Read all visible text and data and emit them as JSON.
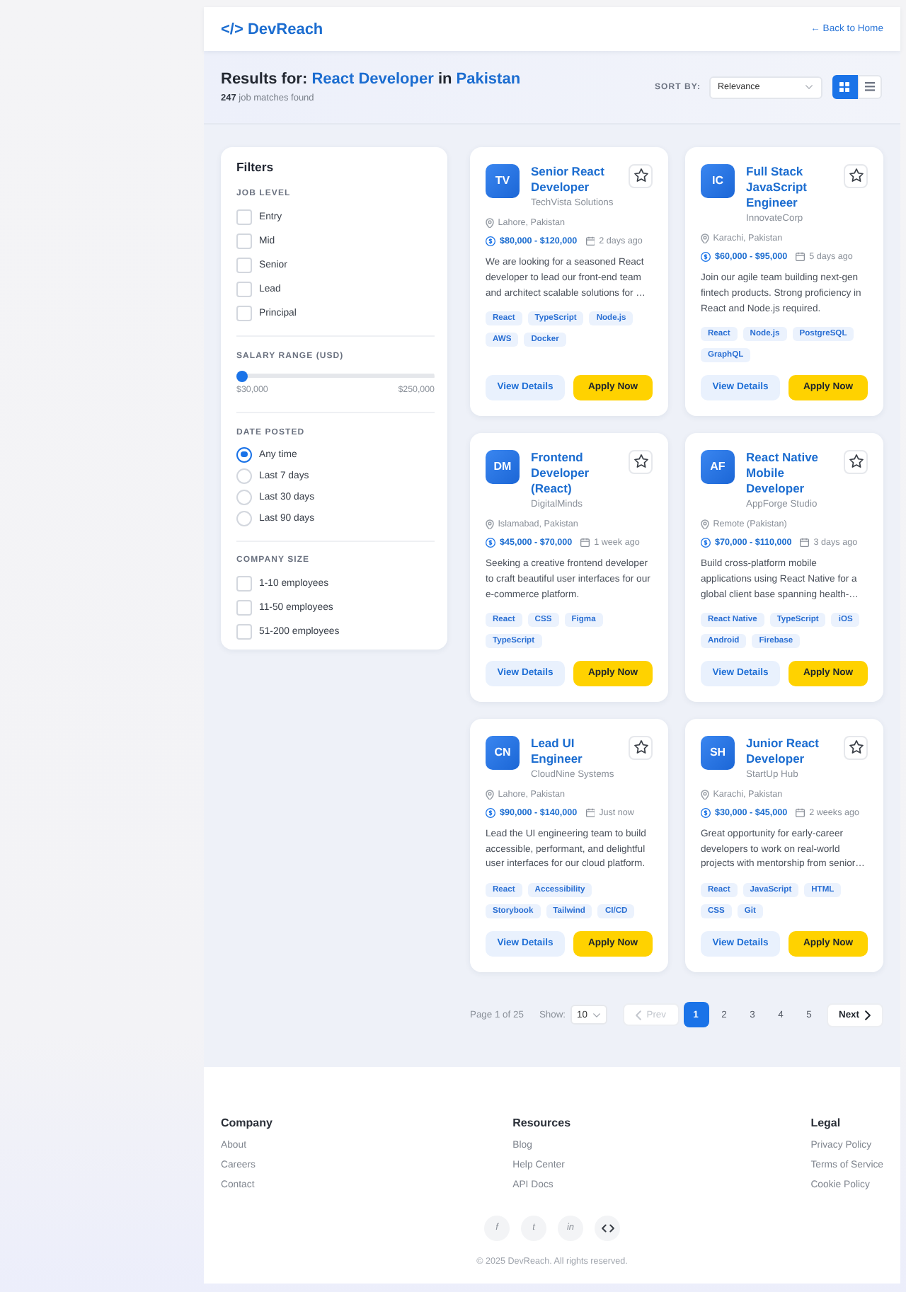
{
  "header": {
    "logo": "</> DevReach",
    "back_link": "← Back to Home"
  },
  "results": {
    "prefix": "Results for:",
    "query": "React Developer",
    "joiner": "in",
    "location": "Pakistan",
    "count": "**247** job matches found",
    "sort_label": "SORT BY:",
    "sort_value": "Relevance",
    "views": [
      {
        "kind": "grid",
        "selected": true
      },
      {
        "kind": "list",
        "selected": false
      }
    ]
  },
  "filters": {
    "title": "Filters",
    "sections": [
      {
        "kind": "checkbox",
        "title": "JOB LEVEL",
        "options": [
          {
            "label": "Entry",
            "checked": false
          },
          {
            "label": "Mid",
            "checked": false
          },
          {
            "label": "Senior",
            "checked": false
          },
          {
            "label": "Lead",
            "checked": false
          },
          {
            "label": "Principal",
            "checked": false
          }
        ]
      },
      {
        "kind": "range",
        "title": "SALARY RANGE (USD)",
        "level": 0,
        "min_label": "$30,000",
        "max_label": "$250,000"
      },
      {
        "kind": "radio",
        "title": "DATE POSTED",
        "options": [
          {
            "label": "Any time",
            "selected": true
          },
          {
            "label": "Last 7 days",
            "selected": false
          },
          {
            "label": "Last 30 days",
            "selected": false
          },
          {
            "label": "Last 90 days",
            "selected": false
          }
        ]
      },
      {
        "kind": "checkbox",
        "title": "COMPANY SIZE",
        "options": [
          {
            "label": "1-10 employees",
            "checked": false
          },
          {
            "label": "11-50 employees",
            "checked": false
          },
          {
            "label": "51-200 employees",
            "checked": false
          }
        ]
      }
    ]
  },
  "jobs": [
    {
      "initials": "TV",
      "title": "Senior React Developer",
      "company": "TechVista Solutions",
      "saved": false,
      "location": "Lahore, Pakistan",
      "salary": "$80,000 - $120,000",
      "posted": "2 days ago",
      "description": "We are looking for a seasoned React developer to lead our front-end team and architect scalable solutions for …",
      "tags": [
        "React",
        "TypeScript",
        "Node.js",
        "AWS",
        "Docker"
      ],
      "details_button": "View Details",
      "apply_button": "Apply Now"
    },
    {
      "initials": "IC",
      "title": "Full Stack JavaScript Engineer",
      "company": "InnovateCorp",
      "saved": false,
      "location": "Karachi, Pakistan",
      "salary": "$60,000 - $95,000",
      "posted": "5 days ago",
      "description": "Join our agile team building next-gen fintech products. Strong proficiency in React and Node.js required.",
      "tags": [
        "React",
        "Node.js",
        "PostgreSQL",
        "GraphQL"
      ],
      "details_button": "View Details",
      "apply_button": "Apply Now"
    },
    {
      "initials": "DM",
      "title": "Frontend Developer (React)",
      "company": "DigitalMinds",
      "saved": false,
      "location": "Islamabad, Pakistan",
      "salary": "$45,000 - $70,000",
      "posted": "1 week ago",
      "description": "Seeking a creative frontend developer to craft beautiful user interfaces for our e-commerce platform.",
      "tags": [
        "React",
        "CSS",
        "Figma",
        "TypeScript"
      ],
      "details_button": "View Details",
      "apply_button": "Apply Now"
    },
    {
      "initials": "AF",
      "title": "React Native Mobile Developer",
      "company": "AppForge Studio",
      "saved": false,
      "location": "Remote (Pakistan)",
      "salary": "$70,000 - $110,000",
      "posted": "3 days ago",
      "description": "Build cross-platform mobile applications using React Native for a global client base spanning health-…",
      "tags": [
        "React Native",
        "TypeScript",
        "iOS",
        "Android",
        "Firebase"
      ],
      "details_button": "View Details",
      "apply_button": "Apply Now"
    },
    {
      "initials": "CN",
      "title": "Lead UI Engineer",
      "company": "CloudNine Systems",
      "saved": false,
      "location": "Lahore, Pakistan",
      "salary": "$90,000 - $140,000",
      "posted": "Just now",
      "description": "Lead the UI engineering team to build accessible, performant, and delightful user interfaces for our cloud platform.",
      "tags": [
        "React",
        "Accessibility",
        "Storybook",
        "Tailwind",
        "CI/CD"
      ],
      "details_button": "View Details",
      "apply_button": "Apply Now"
    },
    {
      "initials": "SH",
      "title": "Junior React Developer",
      "company": "StartUp Hub",
      "saved": false,
      "location": "Karachi, Pakistan",
      "salary": "$30,000 - $45,000",
      "posted": "2 weeks ago",
      "description": "Great opportunity for early-career developers to work on real-world projects with mentorship from senior…",
      "tags": [
        "React",
        "JavaScript",
        "HTML",
        "CSS",
        "Git"
      ],
      "details_button": "View Details",
      "apply_button": "Apply Now"
    }
  ],
  "pagination": {
    "page_info": "Page 1 of 25",
    "show_label": "Show:",
    "page_size": "10",
    "prev": {
      "label": "Prev",
      "disabled": true
    },
    "pages": [
      {
        "label": "1",
        "selected": true
      },
      {
        "label": "2",
        "selected": false
      },
      {
        "label": "3",
        "selected": false
      },
      {
        "label": "4",
        "selected": false
      },
      {
        "label": "5",
        "selected": false
      }
    ],
    "next": {
      "label": "Next",
      "disabled": false
    }
  },
  "footer": {
    "columns": [
      {
        "title": "Company",
        "links": [
          "About",
          "Careers",
          "Contact"
        ]
      },
      {
        "title": "Resources",
        "links": [
          "Blog",
          "Help Center",
          "API Docs"
        ]
      },
      {
        "title": "Legal",
        "links": [
          "Privacy Policy",
          "Terms of Service",
          "Cookie Policy"
        ]
      }
    ],
    "social": [
      {
        "kind": "letter",
        "label": "f"
      },
      {
        "kind": "letter",
        "label": "t"
      },
      {
        "kind": "letter",
        "label": "in"
      },
      {
        "kind": "code"
      }
    ],
    "copyright": "© 2025 DevReach. All rights reserved."
  }
}
